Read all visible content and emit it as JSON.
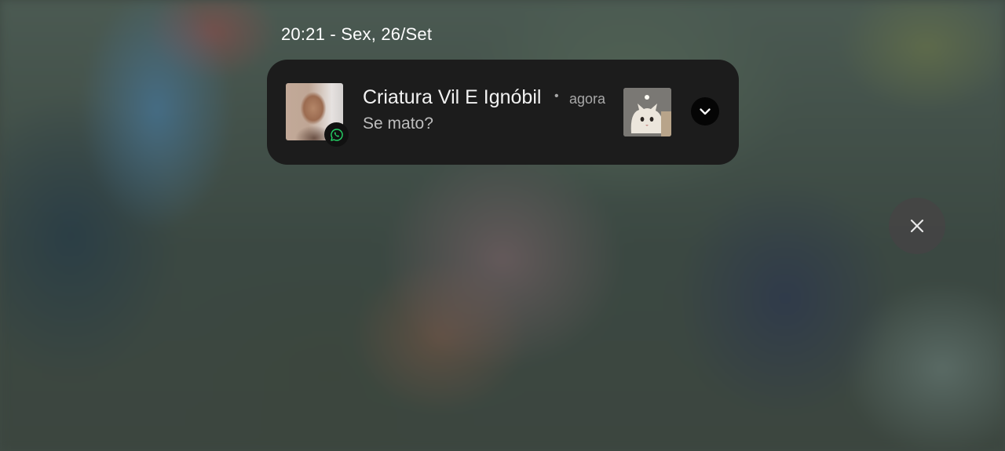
{
  "status": {
    "clock_text": "20:21 - Sex, 26/Set"
  },
  "notification": {
    "sender": "Criatura Vil E Ignóbil",
    "separator": "•",
    "time": "agora",
    "message": "Se mato?",
    "app_icon": "whatsapp-icon",
    "app_color": "#25d366",
    "attachment": "cat-photo-thumbnail",
    "expand_icon": "chevron-down-icon"
  },
  "dismiss": {
    "icon": "close-icon"
  }
}
